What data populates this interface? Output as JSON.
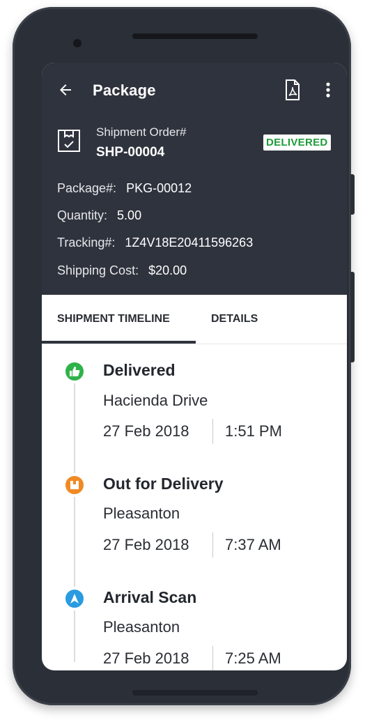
{
  "topbar": {
    "title": "Package"
  },
  "shipment": {
    "order_label": "Shipment Order#",
    "order_number": "SHP-00004",
    "status": "DELIVERED"
  },
  "details": [
    {
      "key": "Package#:",
      "value": "PKG-00012"
    },
    {
      "key": "Quantity:",
      "value": "5.00"
    },
    {
      "key": "Tracking#:",
      "value": "1Z4V18E20411596263"
    },
    {
      "key": "Shipping Cost:",
      "value": "$20.00"
    }
  ],
  "tabs": [
    {
      "label": "SHIPMENT TIMELINE",
      "active": true
    },
    {
      "label": "DETAILS",
      "active": false
    }
  ],
  "timeline": [
    {
      "title": "Delivered",
      "place": "Hacienda Drive",
      "date": "27 Feb 2018",
      "time": "1:51 PM",
      "icon": "thumbs-up-icon",
      "color": "#2fb24a"
    },
    {
      "title": "Out for Delivery",
      "place": "Pleasanton",
      "date": "27 Feb 2018",
      "time": "7:37 AM",
      "icon": "package-icon",
      "color": "#f08a24"
    },
    {
      "title": "Arrival Scan",
      "place": "Pleasanton",
      "date": "27 Feb 2018",
      "time": "7:25 AM",
      "icon": "navigation-arrow-icon",
      "color": "#2a9be0"
    }
  ],
  "colors": {
    "header_bg": "#2f333d",
    "status_green": "#1e9b3a",
    "frame": "#2b2f38"
  }
}
